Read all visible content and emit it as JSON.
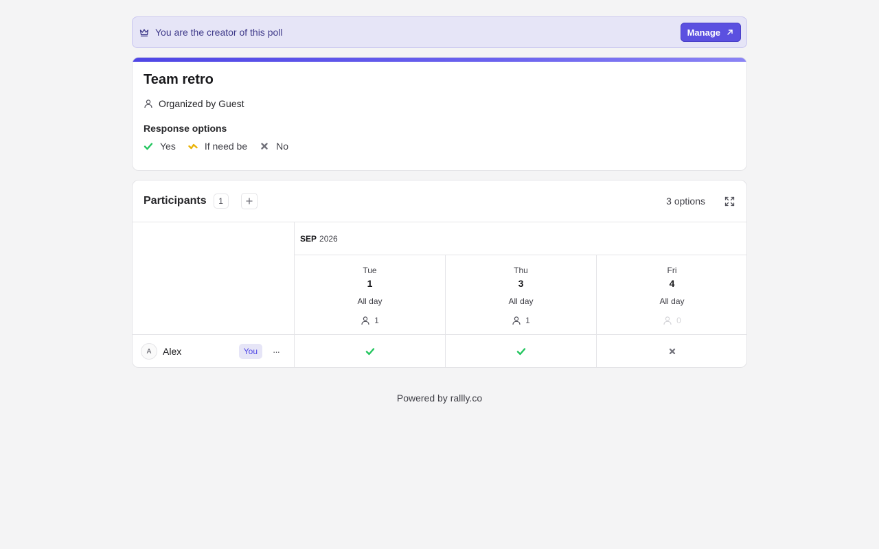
{
  "banner": {
    "message": "You are the creator of this poll",
    "manage_label": "Manage"
  },
  "poll": {
    "title": "Team retro",
    "organizer": "Organized by Guest",
    "response_options_label": "Response options",
    "response_options": [
      {
        "label": "Yes",
        "icon": "check-icon",
        "color": "#22c55e"
      },
      {
        "label": "If need be",
        "icon": "if-need-be-icon",
        "color": "#eab308"
      },
      {
        "label": "No",
        "icon": "cross-icon",
        "color": "#71717a"
      }
    ]
  },
  "participants": {
    "title": "Participants",
    "count": "1",
    "options_count": "3 options",
    "month": "SEP",
    "year": "2026",
    "dates": [
      {
        "dow": "Tue",
        "day": "1",
        "time": "All day",
        "votes": "1"
      },
      {
        "dow": "Thu",
        "day": "3",
        "time": "All day",
        "votes": "1"
      },
      {
        "dow": "Fri",
        "day": "4",
        "time": "All day",
        "votes": "0"
      }
    ],
    "rows": [
      {
        "initial": "A",
        "name": "Alex",
        "badge": "You",
        "more": "···",
        "votes": [
          "yes",
          "yes",
          "no"
        ]
      }
    ]
  },
  "footer": {
    "text": "Powered by rallly.co"
  },
  "colors": {
    "accent": "#5b50e0",
    "yes": "#22c55e",
    "if_need_be": "#eab308",
    "no": "#71717a"
  }
}
